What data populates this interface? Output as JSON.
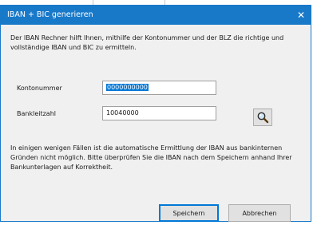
{
  "window": {
    "title": "IBAN + BIC generieren",
    "close_icon": "close-icon"
  },
  "intro_text": "Der IBAN Rechner hilft Ihnen, mithilfe der Kontonummer und der BLZ die richtige und vollständige IBAN und BIC zu ermitteln.",
  "fields": {
    "kontonummer": {
      "label": "Kontonummer",
      "value": "0000000000"
    },
    "bankleitzahl": {
      "label": "Bankleitzahl",
      "value": "10040000"
    }
  },
  "lookup_icon": "magnifier-icon",
  "warning_text": "In einigen wenigen Fällen ist die automatische Ermittlung der IBAN aus bankinternen Gründen nicht möglich. Bitte überprüfen Sie die IBAN nach dem Speichern anhand Ihrer Bankunterlagen auf Korrektheit.",
  "buttons": {
    "save_label": "Speichern",
    "cancel_label": "Abbrechen"
  },
  "colors": {
    "titlebar": "#1979c9",
    "dialog_background": "#f0f0f0",
    "selection": "#0078d7"
  }
}
